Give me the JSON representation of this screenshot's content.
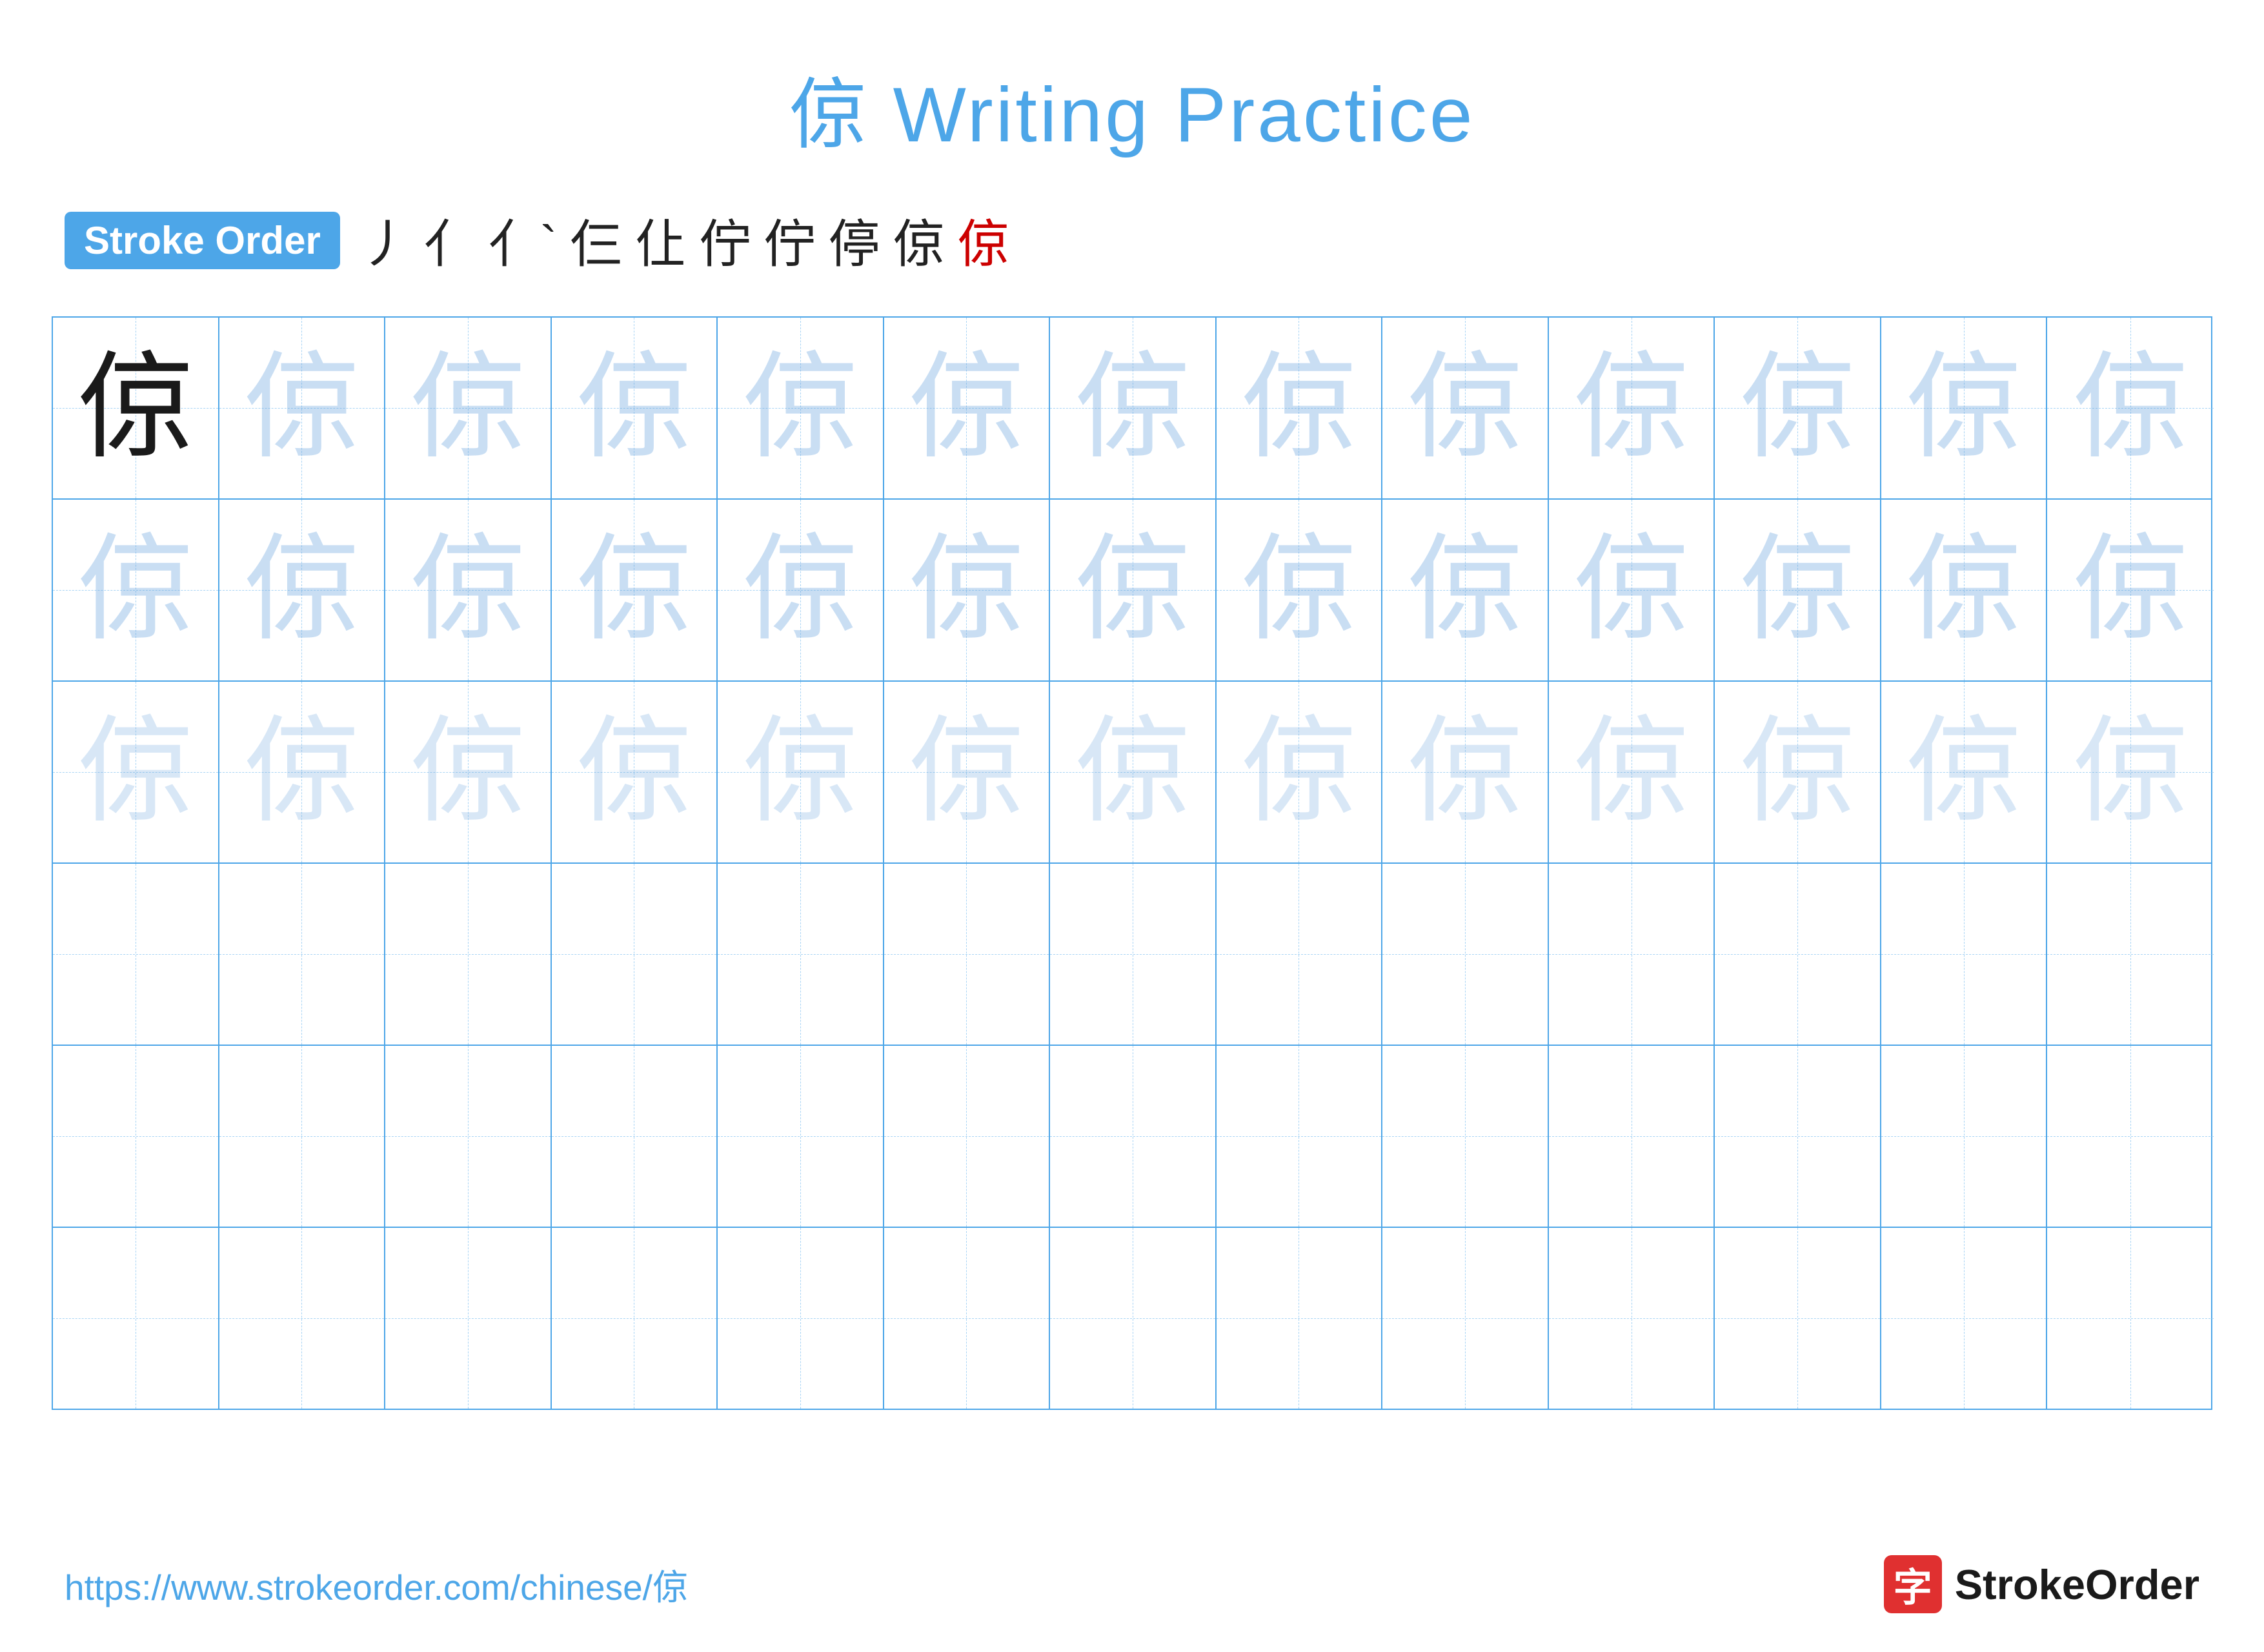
{
  "title": {
    "text": "倞 Writing Practice"
  },
  "stroke_order": {
    "badge_label": "Stroke Order",
    "strokes": [
      "丿",
      "亻",
      "亻`",
      "仨",
      "仩",
      "佇",
      "佇",
      "停",
      "倞",
      "倞"
    ],
    "red_index": 9
  },
  "character": "倞",
  "rows": [
    {
      "type": "filled",
      "opacity_class": [
        "char-dark",
        "char-light1",
        "char-light1",
        "char-light1",
        "char-light1",
        "char-light1",
        "char-light1",
        "char-light1",
        "char-light1",
        "char-light1",
        "char-light1",
        "char-light1",
        "char-light1"
      ]
    },
    {
      "type": "filled",
      "opacity_class": [
        "char-light1",
        "char-light1",
        "char-light1",
        "char-light1",
        "char-light1",
        "char-light1",
        "char-light1",
        "char-light1",
        "char-light1",
        "char-light1",
        "char-light1",
        "char-light1",
        "char-light1"
      ]
    },
    {
      "type": "filled",
      "opacity_class": [
        "char-light2",
        "char-light2",
        "char-light2",
        "char-light2",
        "char-light2",
        "char-light2",
        "char-light2",
        "char-light2",
        "char-light2",
        "char-light2",
        "char-light2",
        "char-light2",
        "char-light2"
      ]
    },
    {
      "type": "empty"
    },
    {
      "type": "empty"
    },
    {
      "type": "empty"
    }
  ],
  "footer": {
    "url": "https://www.strokeorder.com/chinese/倞",
    "logo_icon": "字",
    "logo_text": "StrokeOrder"
  }
}
